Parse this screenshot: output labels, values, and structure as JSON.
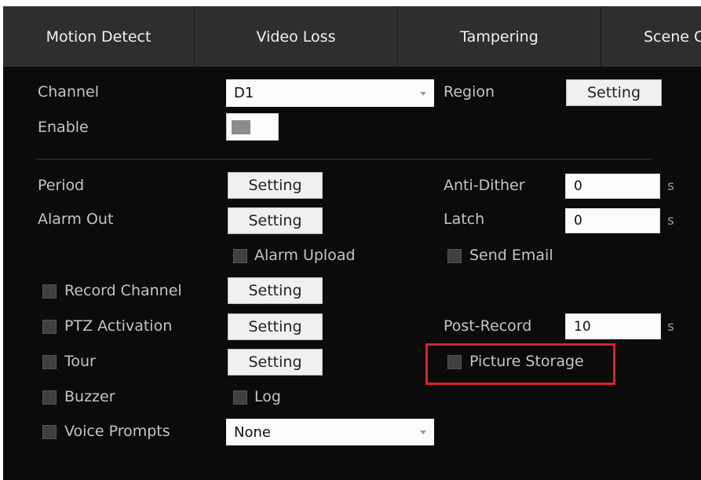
{
  "tabs": [
    {
      "label": "Motion Detect"
    },
    {
      "label": "Video Loss"
    },
    {
      "label": "Tampering"
    },
    {
      "label": "Scene C"
    }
  ],
  "form": {
    "channel_label": "Channel",
    "channel_value": "D1",
    "region_label": "Region",
    "region_button": "Setting",
    "enable_label": "Enable",
    "period_label": "Period",
    "period_button": "Setting",
    "alarm_out_label": "Alarm Out",
    "alarm_out_button": "Setting",
    "alarm_upload_label": "Alarm Upload",
    "anti_dither_label": "Anti-Dither",
    "anti_dither_value": "0",
    "anti_dither_unit": "s",
    "latch_label": "Latch",
    "latch_value": "0",
    "latch_unit": "s",
    "send_email_label": "Send Email",
    "record_channel_label": "Record Channel",
    "record_channel_button": "Setting",
    "ptz_activation_label": "PTZ Activation",
    "ptz_activation_button": "Setting",
    "post_record_label": "Post-Record",
    "post_record_value": "10",
    "post_record_unit": "s",
    "tour_label": "Tour",
    "tour_button": "Setting",
    "picture_storage_label": "Picture Storage",
    "buzzer_label": "Buzzer",
    "log_label": "Log",
    "voice_prompts_label": "Voice Prompts",
    "voice_prompts_value": "None"
  },
  "colors": {
    "background": "#0b0b0b",
    "tabbar": "#2e2e2e",
    "highlight": "#d9232d"
  }
}
